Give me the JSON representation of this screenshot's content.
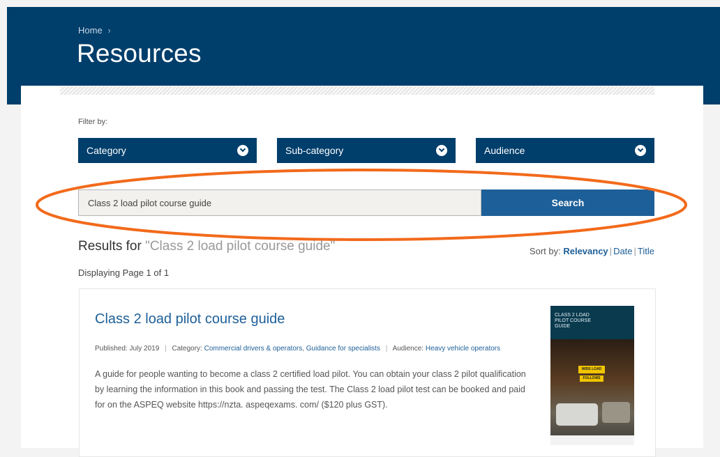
{
  "header": {
    "breadcrumb_home": "Home",
    "breadcrumb_separator": "›",
    "title": "Resources"
  },
  "filters": {
    "label": "Filter by:",
    "category": "Category",
    "subcategory": "Sub-category",
    "audience": "Audience"
  },
  "search": {
    "value": "Class 2 load pilot course guide",
    "button_label": "Search"
  },
  "results": {
    "heading_prefix": "Results for",
    "heading_query": "\"Class 2 load pilot course guide\"",
    "sort_label": "Sort by:",
    "sort_options": [
      "Relevancy",
      "Date",
      "Title"
    ],
    "sort_active": "Relevancy",
    "page_info": "Displaying Page 1 of 1"
  },
  "result_item": {
    "title": "Class 2 load pilot course guide",
    "published_label": "Published:",
    "published_value": "July 2019",
    "category_label": "Category:",
    "category_1": "Commercial drivers & operators",
    "category_2": "Guidance for specialists",
    "audience_label": "Audience:",
    "audience_value": "Heavy vehicle operators",
    "description": "A guide for people wanting to become a class 2 certified load pilot. You can obtain your class 2 pilot qualification by learning the information in this book and passing the test. The Class 2 load pilot test can be booked and paid for on the ASPEQ website https://nzta. aspeqexams. com/ ($120 plus GST).",
    "thumbnail_title": "CLASS 2 LOAD PILOT COURSE GUIDE",
    "thumbnail_sign_1": "WIDE LOAD",
    "thumbnail_sign_2": "FOLLOWS"
  },
  "colors": {
    "header_bg": "#003e6b",
    "button_blue": "#1d5f98",
    "link_blue": "#1d5f98",
    "highlight_orange": "#f26a1b"
  },
  "icons": {
    "dropdown": "chevron-down-circle-icon"
  }
}
